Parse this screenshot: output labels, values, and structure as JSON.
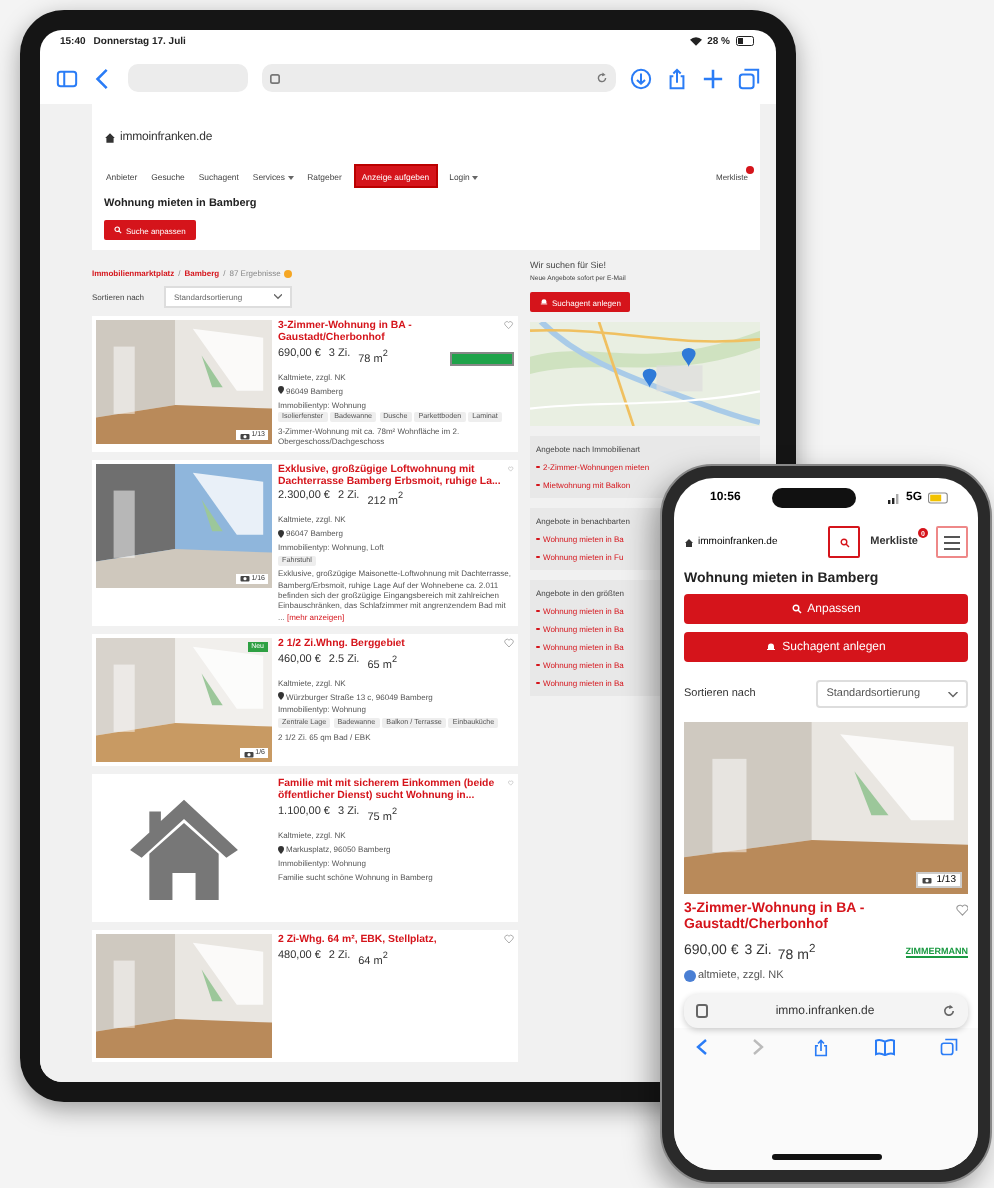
{
  "tablet": {
    "status_bar": {
      "time": "15:40",
      "date": "Donnerstag 17. Juli",
      "battery": "28 %"
    },
    "site": {
      "logo": "immoinfranken.de",
      "nav": [
        {
          "label": "Anbieter",
          "dropdown": false,
          "highlighted": false
        },
        {
          "label": "Gesuche",
          "dropdown": false,
          "highlighted": false
        },
        {
          "label": "Suchagent",
          "dropdown": false,
          "highlighted": false
        },
        {
          "label": "Services",
          "dropdown": true,
          "highlighted": false
        },
        {
          "label": "Ratgeber",
          "dropdown": false,
          "highlighted": false
        },
        {
          "label": "Anzeige aufgeben",
          "dropdown": false,
          "highlighted": true
        },
        {
          "label": "Login",
          "dropdown": true,
          "highlighted": false
        }
      ],
      "wishlist": "Merkliste"
    },
    "heading": "Wohnung mieten in Bamberg",
    "adjust_button": "Suche anpassen",
    "breadcrumb": [
      "Immobilienmarktplatz",
      "Bamberg"
    ],
    "breadcrumb_separator": "/",
    "result_count": "87 Ergebnisse",
    "sort": {
      "label": "Sortieren nach",
      "value": "Standardsortierung"
    },
    "listings": [
      {
        "title": "3-Zimmer-Wohnung in BA - Gaustadt/Cherbonhof",
        "price": "690,00 €",
        "rooms": "3 Zi.",
        "area": "78 m$^{2}$",
        "rent_note": "Kaltmiete, zzgl. NK",
        "address": "96049 Bamberg",
        "type": "Immobilientyp: Wohnung",
        "tags": [
          "Isolierfenster",
          "Badewanne",
          "Dusche",
          "Parkettboden",
          "Laminat"
        ],
        "description": "3-Zimmer-Wohnung mit ca. 78m² Wohnfläche im 2. Obergeschoss/Dachgeschoss",
        "photo_count": "1/13",
        "agent_logo": true
      },
      {
        "title": "Exklusive, großzügige Loftwohnung mit Dachterrasse Bamberg Erbsmoit, ruhige La...",
        "price": "2.300,00 €",
        "rooms": "2 Zi.",
        "area": "212 m$^{2}$",
        "rent_note": "Kaltmiete, zzgl. NK",
        "address": "96047 Bamberg",
        "type": "Immobilientyp: Wohnung, Loft",
        "tags": [
          "Fahrstuhl"
        ],
        "description": "Exklusive, großzügige Maisonette-Loftwohnung mit Dachterrasse, Bamberg/Erbsmoit, ruhige Lage Auf der Wohnebene ca. 2.011 befinden sich der großzügige Eingangsbereich mit zahlreichen Einbauschränken, das Schlafzimmer mit angrenzendem Bad mit ...",
        "more": "[mehr anzeigen]",
        "photo_count": "1/16",
        "agent_logo": false
      },
      {
        "title": "2 1/2 Zi.Whng. Berggebiet",
        "badge": "Neu",
        "price": "460,00 €",
        "rooms": "2.5 Zi.",
        "area": "65 m$^{2}$",
        "rent_note": "Kaltmiete, zzgl. NK",
        "address": "Würzburger Straße 13 c, 96049 Bamberg",
        "type": "Immobilientyp: Wohnung",
        "tags": [
          "Zentrale Lage",
          "Badewanne",
          "Balkon / Terrasse",
          "Einbauküche"
        ],
        "description": "2 1/2 Zi. 65 qm Bad / EBK",
        "photo_count": "1/6",
        "agent_logo": false
      },
      {
        "kind": "placeholder",
        "title": "Familie mit mit sicherem Einkommen (beide öffentlicher Dienst) sucht Wohnung in...",
        "price": "1.100,00 €",
        "rooms": "3 Zi.",
        "area": "75 m$^{2}$",
        "rent_note": "Kaltmiete, zzgl. NK",
        "address": "Markusplatz, 96050 Bamberg",
        "type": "Immobilientyp: Wohnung",
        "description": "Familie sucht schöne Wohnung in Bamberg",
        "agent_logo": false
      },
      {
        "title": "2 Zi-Whg. 64 m², EBK, Stellplatz,",
        "price": "480,00 €",
        "rooms": "2 Zi.",
        "area": "64 m$^{2}$",
        "agent_logo": false
      }
    ],
    "sidebar": {
      "search_title": "Wir suchen für Sie!",
      "search_text": "Neue Angebote sofort per E-Mail",
      "agent_button": "Suchagent anlegen",
      "sections": [
        {
          "title": "Angebote nach Immobilienart",
          "links": [
            "2-Zimmer-Wohnungen mieten",
            "Mietwohnung mit Balkon"
          ]
        },
        {
          "title": "Angebote in benachbarten",
          "links": [
            "Wohnung mieten in Ba",
            "Wohnung mieten in Fu"
          ]
        },
        {
          "title": "Angebote in den größten",
          "links": [
            "Wohnung mieten in Ba",
            "Wohnung mieten in Ba",
            "Wohnung mieten in Ba",
            "Wohnung mieten in Ba",
            "Wohnung mieten in Ba"
          ]
        }
      ]
    }
  },
  "phone": {
    "status_bar": {
      "time": "10:56",
      "network": "5G"
    },
    "logo": "immoinfranken.de",
    "wishlist": "Merkliste",
    "wishlist_count": "0",
    "heading": "Wohnung mieten in Bamberg",
    "adjust_button": "Anpassen",
    "agent_button": "Suchagent anlegen",
    "sort": {
      "label": "Sortieren nach",
      "value": "Standardsortierung"
    },
    "listing": {
      "photo_count": "1/13",
      "title": "3-Zimmer-Wohnung in BA - Gaustadt/Cherbonhof",
      "price": "690,00 €",
      "rooms": "3 Zi.",
      "area": "78 m$^{2}$",
      "rent_note": "altmiete, zzgl. NK",
      "agent_logo": "ZIMMERMANN"
    },
    "url": "immo.infranken.de"
  }
}
